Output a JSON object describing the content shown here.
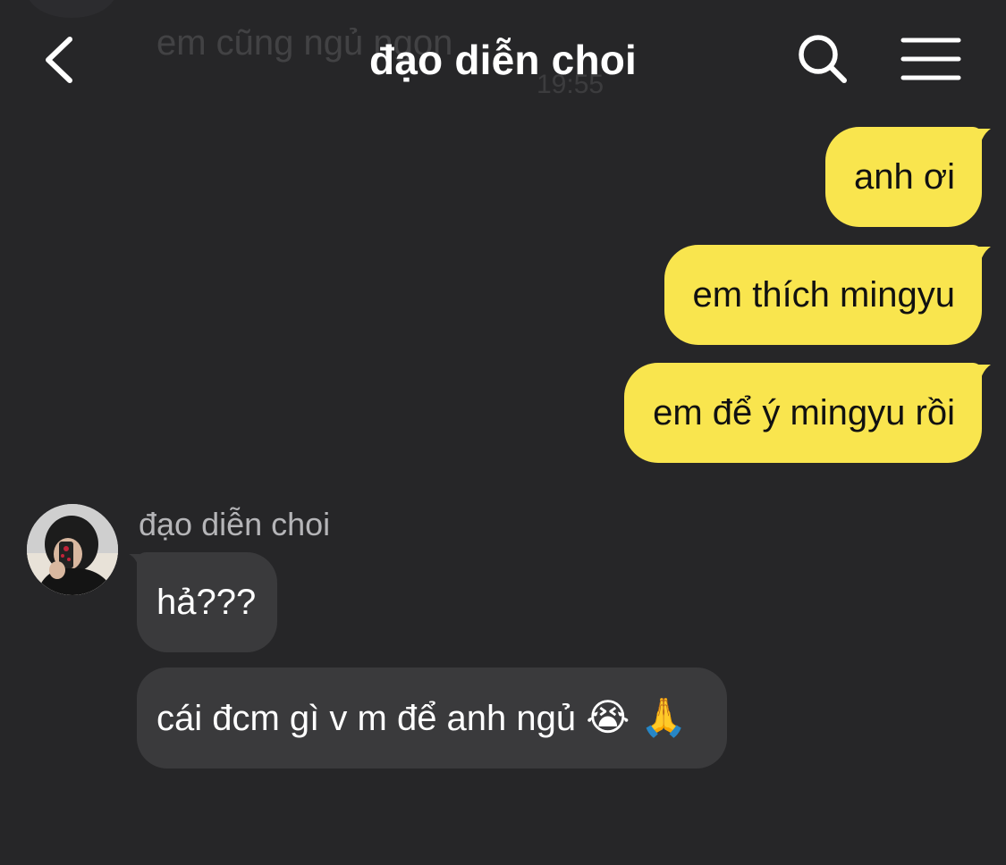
{
  "background_behind": {
    "preview_text": "em cũng ngủ ngon",
    "preview_time": "19:55"
  },
  "header": {
    "title": "đạo diễn choi",
    "back_icon": "chevron-left-icon",
    "search_icon": "search-icon",
    "menu_icon": "hamburger-menu-icon"
  },
  "colors": {
    "background": "#262628",
    "outgoing_bubble": "#f9e54e",
    "incoming_bubble": "#3a3a3c"
  },
  "messages_outgoing": [
    {
      "text": "anh ơi"
    },
    {
      "text": "em thích mingyu"
    },
    {
      "text": "em để ý mingyu rồi"
    }
  ],
  "incoming": {
    "sender_name": "đạo diễn choi",
    "messages": [
      {
        "text": "hả???"
      },
      {
        "text": "cái đcm gì v m để anh ngủ",
        "emojis": "😭 🙏"
      }
    ]
  }
}
